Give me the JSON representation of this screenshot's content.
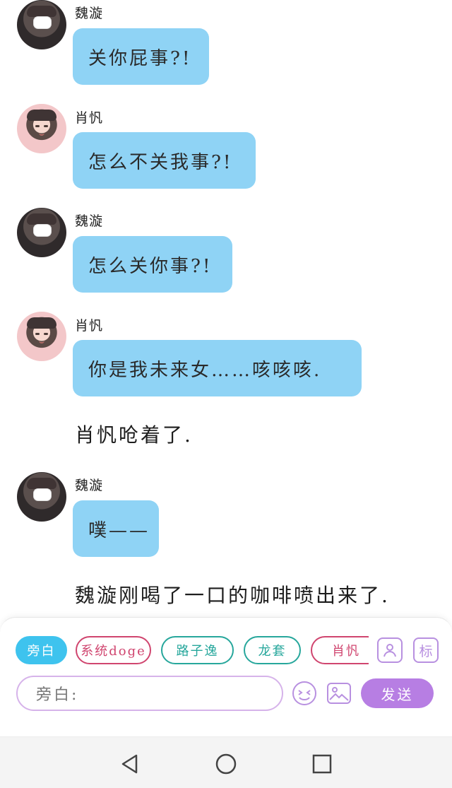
{
  "messages": [
    {
      "type": "chat",
      "speaker": "魏漩",
      "text": "关你屁事?!"
    },
    {
      "type": "chat",
      "speaker": "肖忛",
      "text": "怎么不关我事?!"
    },
    {
      "type": "chat",
      "speaker": "魏漩",
      "text": "怎么关你事?!"
    },
    {
      "type": "chat",
      "speaker": "肖忛",
      "text": "你是我未来女……咳咳咳."
    },
    {
      "type": "narration",
      "text": "肖忛呛着了."
    },
    {
      "type": "chat",
      "speaker": "魏漩",
      "text": "噗——"
    },
    {
      "type": "narration",
      "text": "魏漩刚喝了一口的咖啡喷出来了."
    }
  ],
  "composer": {
    "roles": [
      "旁白",
      "系统doge",
      "路子逸",
      "龙套",
      "肖忛"
    ],
    "input_placeholder": "旁白:",
    "send_label": "发送",
    "tag_label": "标"
  },
  "colors": {
    "bubble": "#8fd3f5",
    "active_chip": "#3ec3ee",
    "send": "#b77ee3",
    "accent_pink": "#d0456f",
    "accent_teal": "#27a79c"
  },
  "icons": [
    "profile-icon",
    "tag-icon",
    "emoji-icon",
    "image-icon",
    "back-icon",
    "home-icon",
    "recents-icon"
  ]
}
